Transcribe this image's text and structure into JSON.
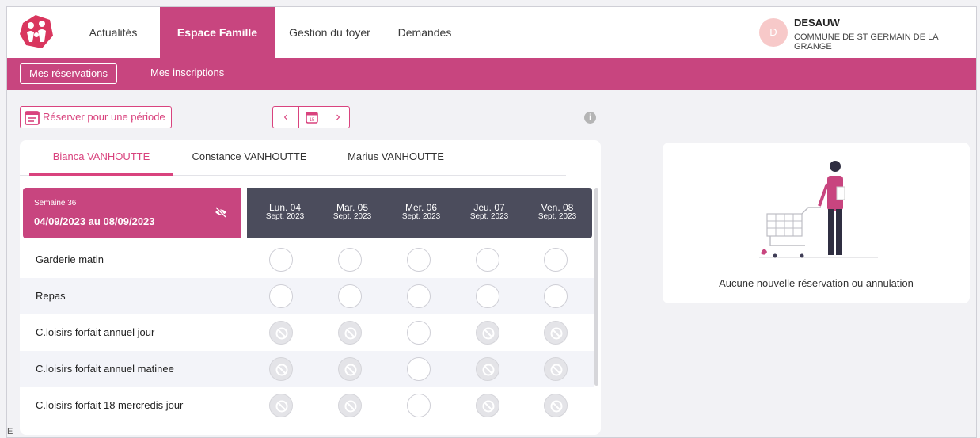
{
  "nav": {
    "items": [
      {
        "label": "Actualités"
      },
      {
        "label": "Espace Famille"
      },
      {
        "label": "Gestion du foyer"
      },
      {
        "label": "Demandes"
      }
    ]
  },
  "user": {
    "initial": "D",
    "name": "DESAUW",
    "commune": "COMMUNE DE ST GERMAIN DE LA GRANGE"
  },
  "subnav": {
    "items": [
      {
        "label": "Mes réservations"
      },
      {
        "label": "Mes inscriptions"
      }
    ]
  },
  "toolbar": {
    "period_label": "Réserver pour une période",
    "calendar_day": "15"
  },
  "children": [
    {
      "label": "Bianca VANHOUTTE"
    },
    {
      "label": "Constance VANHOUTTE"
    },
    {
      "label": "Marius VANHOUTTE"
    }
  ],
  "week": {
    "label": "Semaine 36",
    "range": "04/09/2023 au 08/09/2023"
  },
  "days": [
    {
      "day": "Lun. 04",
      "month": "Sept. 2023"
    },
    {
      "day": "Mar. 05",
      "month": "Sept. 2023"
    },
    {
      "day": "Mer. 06",
      "month": "Sept. 2023"
    },
    {
      "day": "Jeu. 07",
      "month": "Sept. 2023"
    },
    {
      "day": "Ven. 08",
      "month": "Sept. 2023"
    }
  ],
  "activities": [
    {
      "label": "Garderie matin",
      "slots": [
        "open",
        "open",
        "open",
        "open",
        "open"
      ]
    },
    {
      "label": "Repas",
      "slots": [
        "open",
        "open",
        "open",
        "open",
        "open"
      ]
    },
    {
      "label": "C.loisirs forfait annuel jour",
      "slots": [
        "blocked",
        "blocked",
        "open",
        "blocked",
        "blocked"
      ]
    },
    {
      "label": "C.loisirs forfait annuel matinee",
      "slots": [
        "blocked",
        "blocked",
        "open",
        "blocked",
        "blocked"
      ]
    },
    {
      "label": "C.loisirs forfait 18 mercredis jour",
      "slots": [
        "blocked",
        "blocked",
        "open",
        "blocked",
        "blocked"
      ]
    }
  ],
  "side": {
    "empty_text": "Aucune nouvelle réservation ou annulation"
  },
  "stray_char": "E",
  "colors": {
    "accent": "#c8457f",
    "dark_header": "#4b4c5c"
  }
}
